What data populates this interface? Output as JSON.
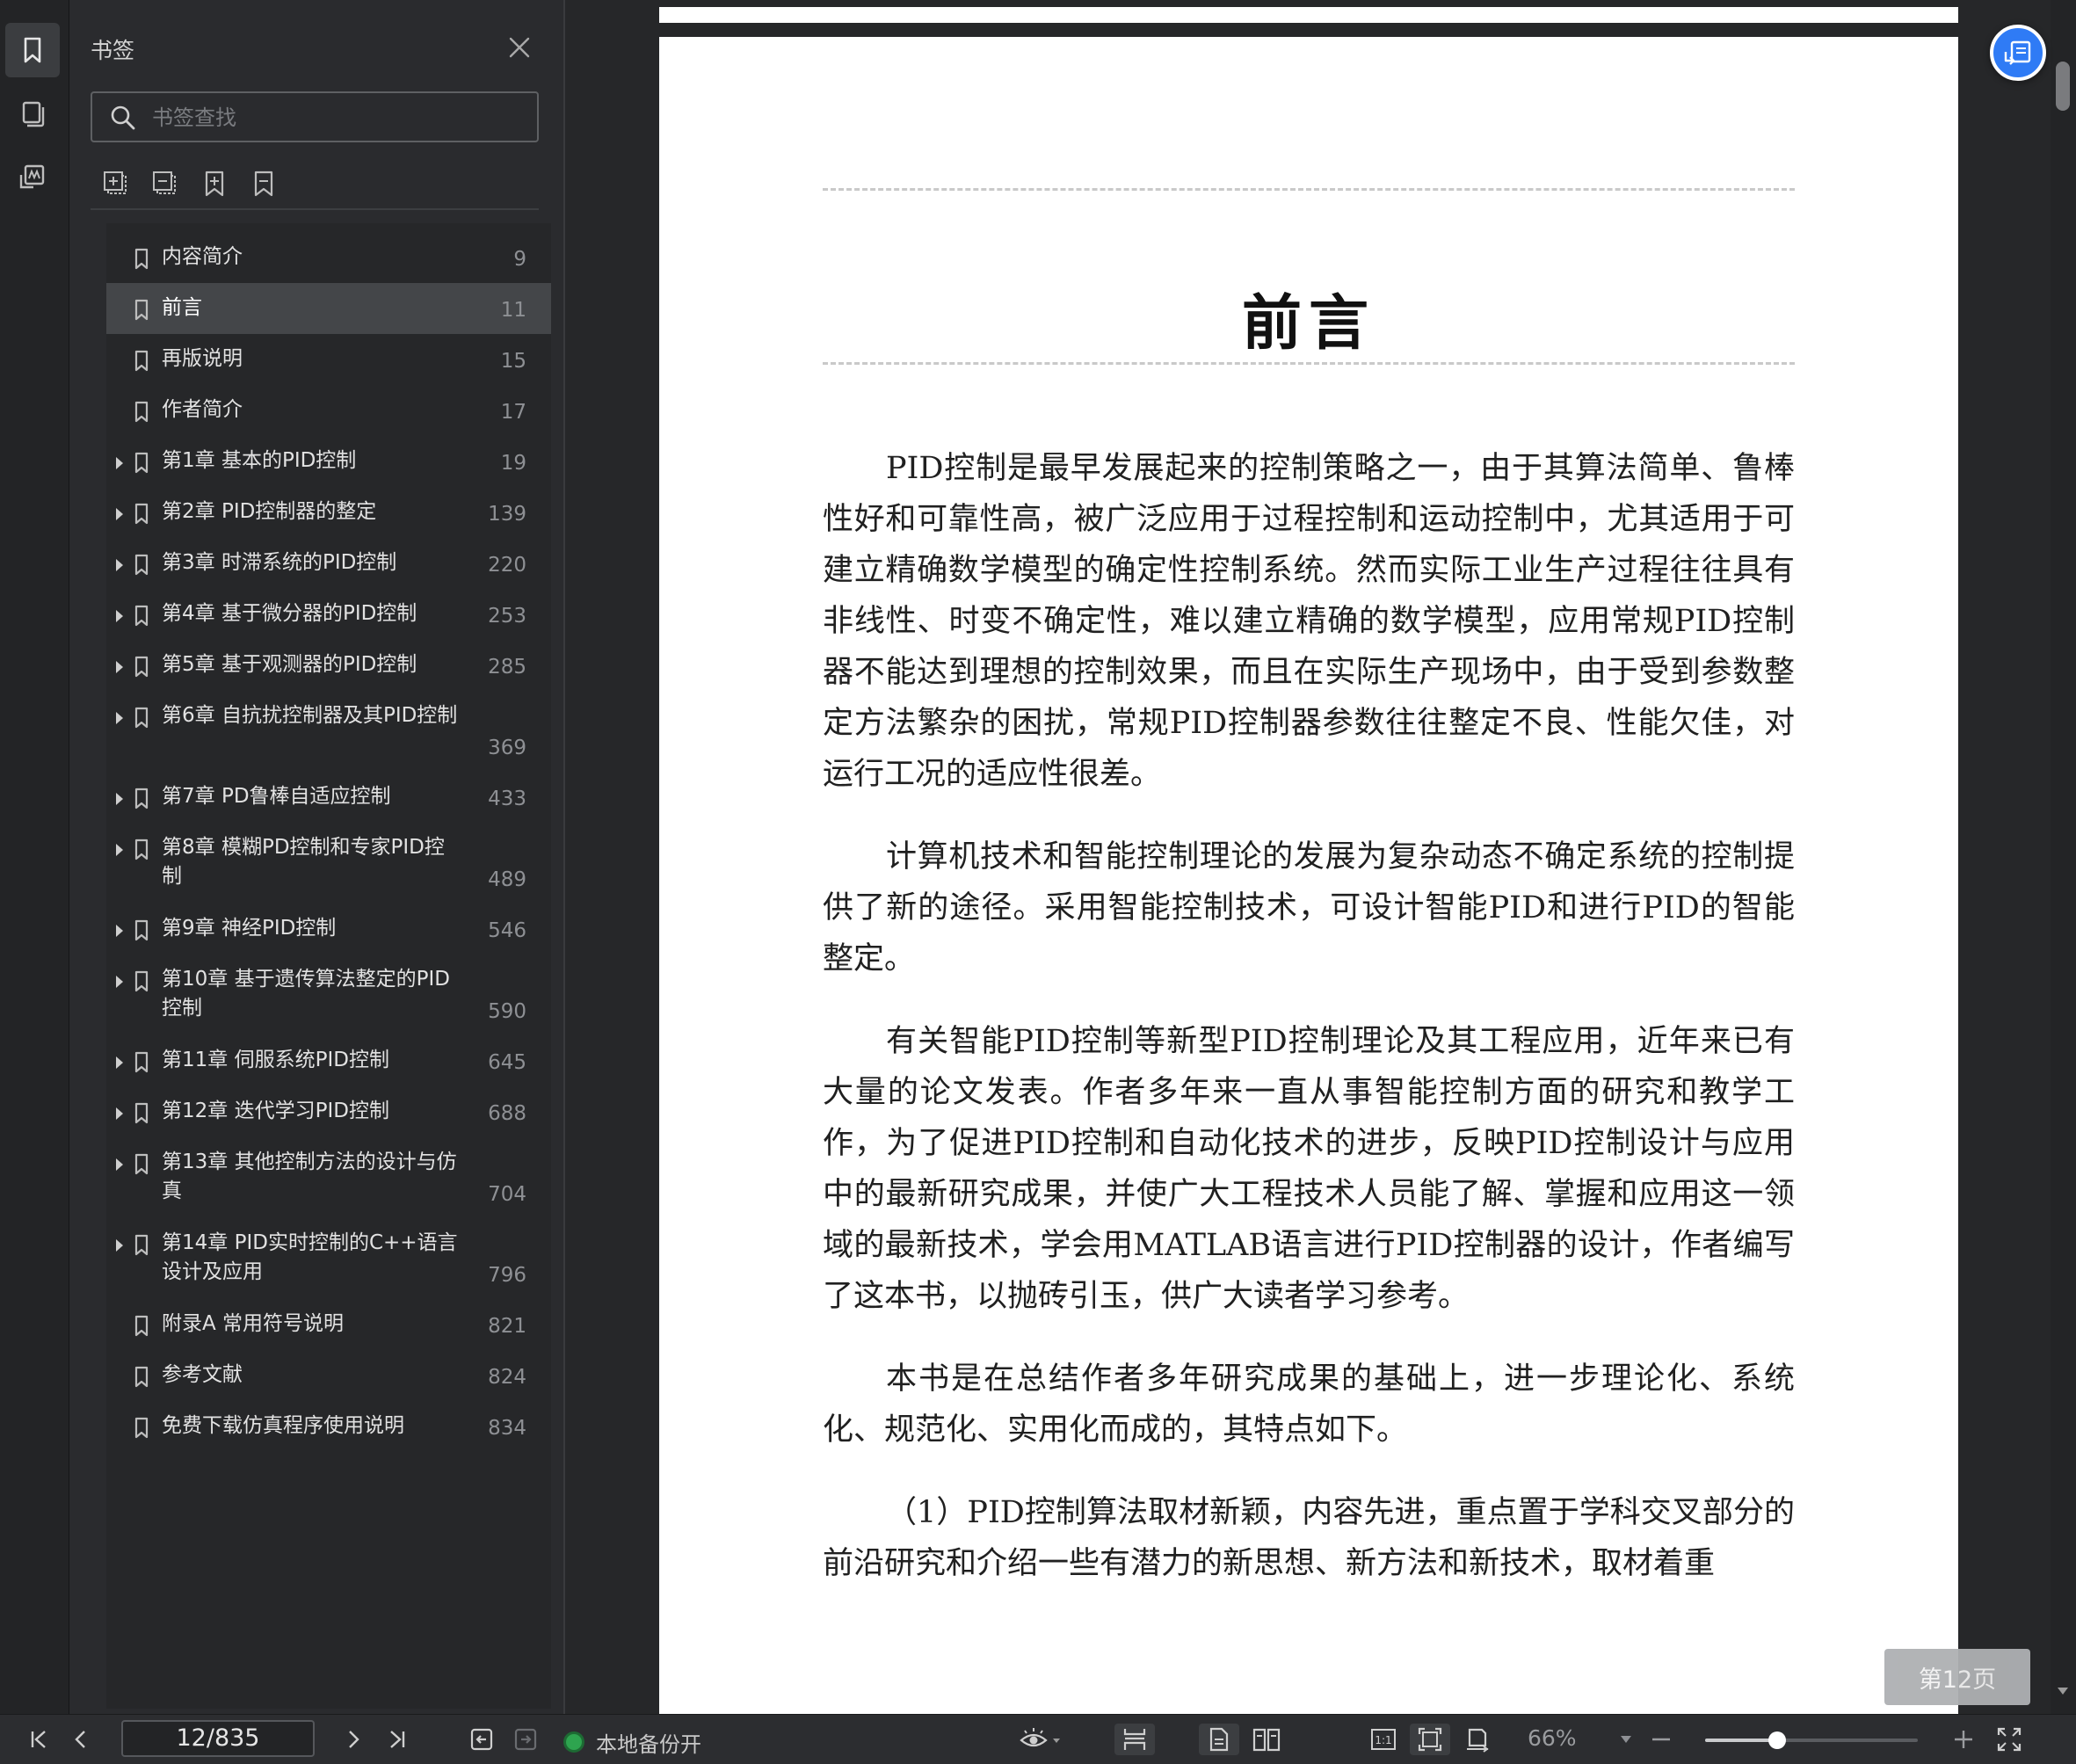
{
  "sidebar_rail": {
    "items": [
      {
        "icon": "bookmark-icon",
        "active": true
      },
      {
        "icon": "thumbnails-icon",
        "active": false
      },
      {
        "icon": "annotations-icon",
        "active": false
      }
    ]
  },
  "bookmark_panel": {
    "title": "书签",
    "search_placeholder": "书签查找",
    "tools": [
      "expand-all-icon",
      "collapse-all-icon",
      "add-bookmark-icon",
      "remove-bookmark-icon"
    ],
    "items": [
      {
        "label": "内容简介",
        "page": "9",
        "expandable": false,
        "selected": false
      },
      {
        "label": "前言",
        "page": "11",
        "expandable": false,
        "selected": true
      },
      {
        "label": "再版说明",
        "page": "15",
        "expandable": false,
        "selected": false
      },
      {
        "label": "作者简介",
        "page": "17",
        "expandable": false,
        "selected": false
      },
      {
        "label": "第1章  基本的PID控制",
        "page": "19",
        "expandable": true,
        "selected": false
      },
      {
        "label": "第2章  PID控制器的整定",
        "page": "139",
        "expandable": true,
        "selected": false
      },
      {
        "label": "第3章  时滞系统的PID控制",
        "page": "220",
        "expandable": true,
        "selected": false
      },
      {
        "label": "第4章  基于微分器的PID控制",
        "page": "253",
        "expandable": true,
        "selected": false
      },
      {
        "label": "第5章  基于观测器的PID控制",
        "page": "285",
        "expandable": true,
        "selected": false
      },
      {
        "label": "第6章  自抗扰控制器及其PID控制",
        "page": "369",
        "expandable": true,
        "selected": false
      },
      {
        "label": "第7章  PD鲁棒自适应控制",
        "page": "433",
        "expandable": true,
        "selected": false
      },
      {
        "label": "第8章  模糊PD控制和专家PID控制",
        "page": "489",
        "expandable": true,
        "selected": false
      },
      {
        "label": "第9章  神经PID控制",
        "page": "546",
        "expandable": true,
        "selected": false
      },
      {
        "label": "第10章  基于遗传算法整定的PID控制",
        "page": "590",
        "expandable": true,
        "selected": false
      },
      {
        "label": "第11章  伺服系统PID控制",
        "page": "645",
        "expandable": true,
        "selected": false
      },
      {
        "label": "第12章  迭代学习PID控制",
        "page": "688",
        "expandable": true,
        "selected": false
      },
      {
        "label": "第13章  其他控制方法的设计与仿真",
        "page": "704",
        "expandable": true,
        "selected": false
      },
      {
        "label": "第14章  PID实时控制的C++语言设计及应用",
        "page": "796",
        "expandable": true,
        "selected": false
      },
      {
        "label": "附录A  常用符号说明",
        "page": "821",
        "expandable": false,
        "selected": false
      },
      {
        "label": "参考文献",
        "page": "824",
        "expandable": false,
        "selected": false
      },
      {
        "label": "免费下载仿真程序使用说明",
        "page": "834",
        "expandable": false,
        "selected": false
      }
    ]
  },
  "document": {
    "heading": "前言",
    "paragraphs": [
      "PID控制是最早发展起来的控制策略之一，由于其算法简单、鲁棒性好和可靠性高，被广泛应用于过程控制和运动控制中，尤其适用于可建立精确数学模型的确定性控制系统。然而实际工业生产过程往往具有非线性、时变不确定性，难以建立精确的数学模型，应用常规PID控制器不能达到理想的控制效果，而且在实际生产现场中，由于受到参数整定方法繁杂的困扰，常规PID控制器参数往往整定不良、性能欠佳，对运行工况的适应性很差。",
      "计算机技术和智能控制理论的发展为复杂动态不确定系统的控制提供了新的途径。采用智能控制技术，可设计智能PID和进行PID的智能整定。",
      "有关智能PID控制等新型PID控制理论及其工程应用，近年来已有大量的论文发表。作者多年来一直从事智能控制方面的研究和教学工作，为了促进PID控制和自动化技术的进步，反映PID控制设计与应用中的最新研究成果，并使广大工程技术人员能了解、掌握和应用这一领域的最新技术，学会用MATLAB语言进行PID控制器的设计，作者编写了这本书，以抛砖引玉，供广大读者学习参考。",
      "本书是在总结作者多年研究成果的基础上，进一步理论化、系统化、规范化、实用化而成的，其特点如下。",
      "（1）PID控制算法取材新颖，内容先进，重点置于学科交叉部分的前沿研究和介绍一些有潜力的新思想、新方法和新技术，取材着重"
    ],
    "page_tag": "第12页"
  },
  "bottom_bar": {
    "page_indicator": "12/835",
    "backup_status": "本地备份开",
    "zoom_level": "66%",
    "zoom_fraction": 0.34
  },
  "colors": {
    "accent": "#2f7bf5",
    "backup_ok": "#2ea44f",
    "panel_bg": "#2a2b2e",
    "selected_row": "#444649"
  }
}
